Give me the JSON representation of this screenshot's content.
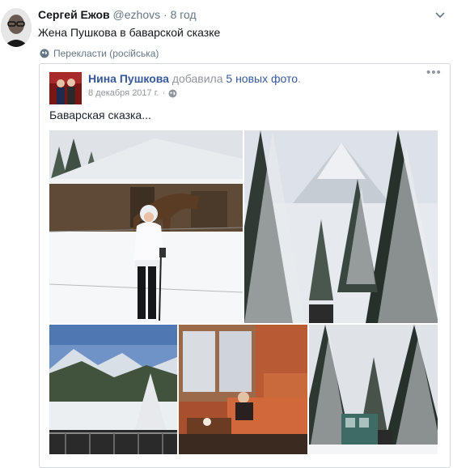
{
  "tweet": {
    "author_name": "Сергей Ежов",
    "author_handle": "@ezhovs",
    "separator": "·",
    "time": "8 год",
    "text": "Жена Пушкова в баварской сказке",
    "translate_label": "Перекласти (російська)",
    "menu_icon": "chevron-down-icon"
  },
  "embed": {
    "author_name": "Нина Пушкова",
    "action": "добавила",
    "photos_link": "5 новых фото",
    "period": ".",
    "date": "8 декабря 2017 г.",
    "date_separator": "·",
    "menu_label": "•••",
    "caption": "Баварская сказка...",
    "photos": [
      {
        "name": "horse-stable-snow-photo"
      },
      {
        "name": "snowy-mountain-forest-photo"
      },
      {
        "name": "alpine-valley-view-photo"
      },
      {
        "name": "hotel-room-photo"
      },
      {
        "name": "snowy-forest-carriage-photo"
      }
    ]
  },
  "colors": {
    "text": "#14171a",
    "muted": "#657786",
    "fb_link": "#365899",
    "fb_muted": "#90949c",
    "border": "#d3d6db"
  }
}
